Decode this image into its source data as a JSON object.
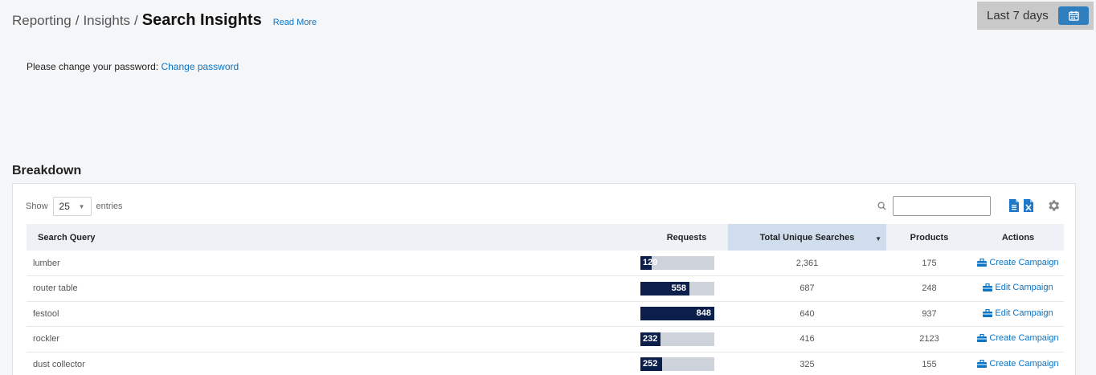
{
  "header": {
    "breadcrumb": [
      "Reporting",
      "Insights"
    ],
    "title": "Search Insights",
    "read_more": "Read More"
  },
  "date_range": {
    "label": "Last 7 days"
  },
  "notice": {
    "text": "Please change your password:",
    "link": "Change password"
  },
  "section": {
    "title": "Breakdown"
  },
  "table_controls": {
    "show_label": "Show",
    "page_size": "25",
    "entries_label": "entries",
    "search_value": ""
  },
  "columns": {
    "query": "Search Query",
    "requests": "Requests",
    "unique": "Total Unique Searches",
    "products": "Products",
    "actions": "Actions"
  },
  "rows": [
    {
      "query": "lumber",
      "requests": "129",
      "req_fraction": 0.152,
      "unique": "2,361",
      "products": "175",
      "action": "Create Campaign"
    },
    {
      "query": "router table",
      "requests": "558",
      "req_fraction": 0.658,
      "unique": "687",
      "products": "248",
      "action": "Edit Campaign"
    },
    {
      "query": "festool",
      "requests": "848",
      "req_fraction": 1.0,
      "unique": "640",
      "products": "937",
      "action": "Edit Campaign"
    },
    {
      "query": "rockler",
      "requests": "232",
      "req_fraction": 0.274,
      "unique": "416",
      "products": "2123",
      "action": "Create Campaign"
    },
    {
      "query": "dust collector",
      "requests": "252",
      "req_fraction": 0.297,
      "unique": "325",
      "products": "155",
      "action": "Create Campaign"
    }
  ],
  "colors": {
    "accent": "#0b74c4",
    "bar_fill": "#0c1f4a",
    "bar_track": "#cdd2db",
    "sorted_header": "#cfdded"
  },
  "icons": [
    "calendar-icon",
    "search-icon",
    "csv-export-icon",
    "excel-export-icon",
    "gear-icon",
    "campaign-icon"
  ]
}
